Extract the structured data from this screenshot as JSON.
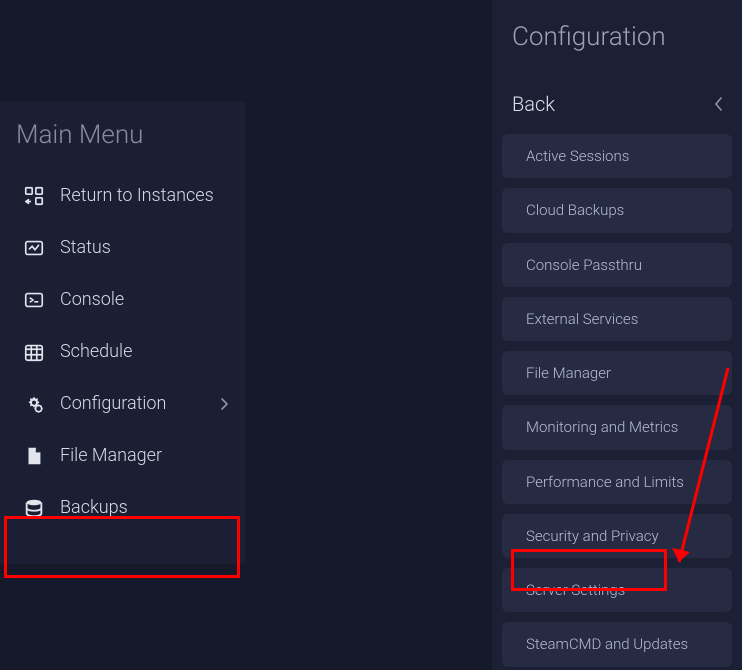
{
  "mainMenu": {
    "title": "Main Menu",
    "items": [
      {
        "icon": "instances-icon",
        "label": "Return to Instances"
      },
      {
        "icon": "status-icon",
        "label": "Status"
      },
      {
        "icon": "console-icon",
        "label": "Console"
      },
      {
        "icon": "schedule-icon",
        "label": "Schedule"
      },
      {
        "icon": "configuration-icon",
        "label": "Configuration",
        "hasChevron": true
      },
      {
        "icon": "file-icon",
        "label": "File Manager"
      },
      {
        "icon": "backups-icon",
        "label": "Backups"
      }
    ]
  },
  "configPanel": {
    "title": "Configuration",
    "backLabel": "Back",
    "items": [
      "Active Sessions",
      "Cloud Backups",
      "Console Passthru",
      "External Services",
      "File Manager",
      "Monitoring and Metrics",
      "Performance and Limits",
      "Security and Privacy",
      "Server Settings",
      "SteamCMD and Updates"
    ]
  }
}
